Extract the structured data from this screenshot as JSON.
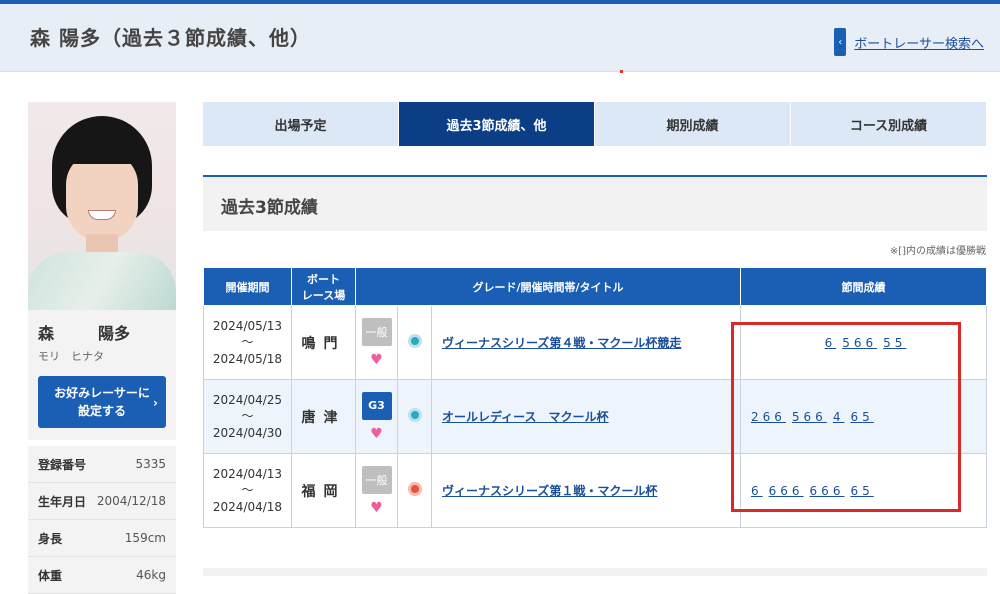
{
  "header": {
    "title": "森 陽多（過去３節成績、他）",
    "search_link": "ボートレーサー検索へ",
    "search_chevron": "‹"
  },
  "profile": {
    "name_family": "森",
    "name_given": "陽多",
    "kana": "モリ　ヒナタ",
    "fav_button": "お好みレーサーに\n設定する",
    "fav_arrow": "›",
    "info": [
      {
        "label": "登録番号",
        "value": "5335"
      },
      {
        "label": "生年月日",
        "value": "2004/12/18"
      },
      {
        "label": "身長",
        "value": "159cm"
      },
      {
        "label": "体重",
        "value": "46kg"
      }
    ]
  },
  "tabs": [
    {
      "label": "出場予定",
      "active": false
    },
    {
      "label": "過去3節成績、他",
      "active": true
    },
    {
      "label": "期別成績",
      "active": false
    },
    {
      "label": "コース別成績",
      "active": false
    }
  ],
  "section": {
    "title": "過去3節成績",
    "note": "※[]内の成績は優勝戦"
  },
  "table": {
    "headers": [
      "開催期間",
      "ボート\nレース場",
      "グレード/開催時間帯/タイトル",
      "節間成績"
    ],
    "rows": [
      {
        "start": "2024/05/13",
        "tilde": "〜",
        "end": "2024/05/18",
        "venue": "鳴門",
        "grade": "一般",
        "time": "day",
        "title": "ヴィーナスシリーズ第４戦・マクール杯競走",
        "results": [
          "6",
          "566",
          "55"
        ]
      },
      {
        "start": "2024/04/25",
        "tilde": "〜",
        "end": "2024/04/30",
        "venue": "唐津",
        "grade": "G3",
        "time": "day",
        "title": "オールレディース　マクール杯",
        "results": [
          "266",
          "566",
          "4",
          "65"
        ]
      },
      {
        "start": "2024/04/13",
        "tilde": "〜",
        "end": "2024/04/18",
        "venue": "福岡",
        "grade": "一般",
        "time": "night",
        "title": "ヴィーナスシリーズ第１戦・マクール杯",
        "results": [
          "6",
          "666",
          "666",
          "65"
        ]
      }
    ]
  },
  "icons": {
    "heart": "♥"
  },
  "colors": {
    "primary": "#1b5fb4",
    "active_tab": "#0c3e86",
    "highlight": "#d92a2a"
  }
}
